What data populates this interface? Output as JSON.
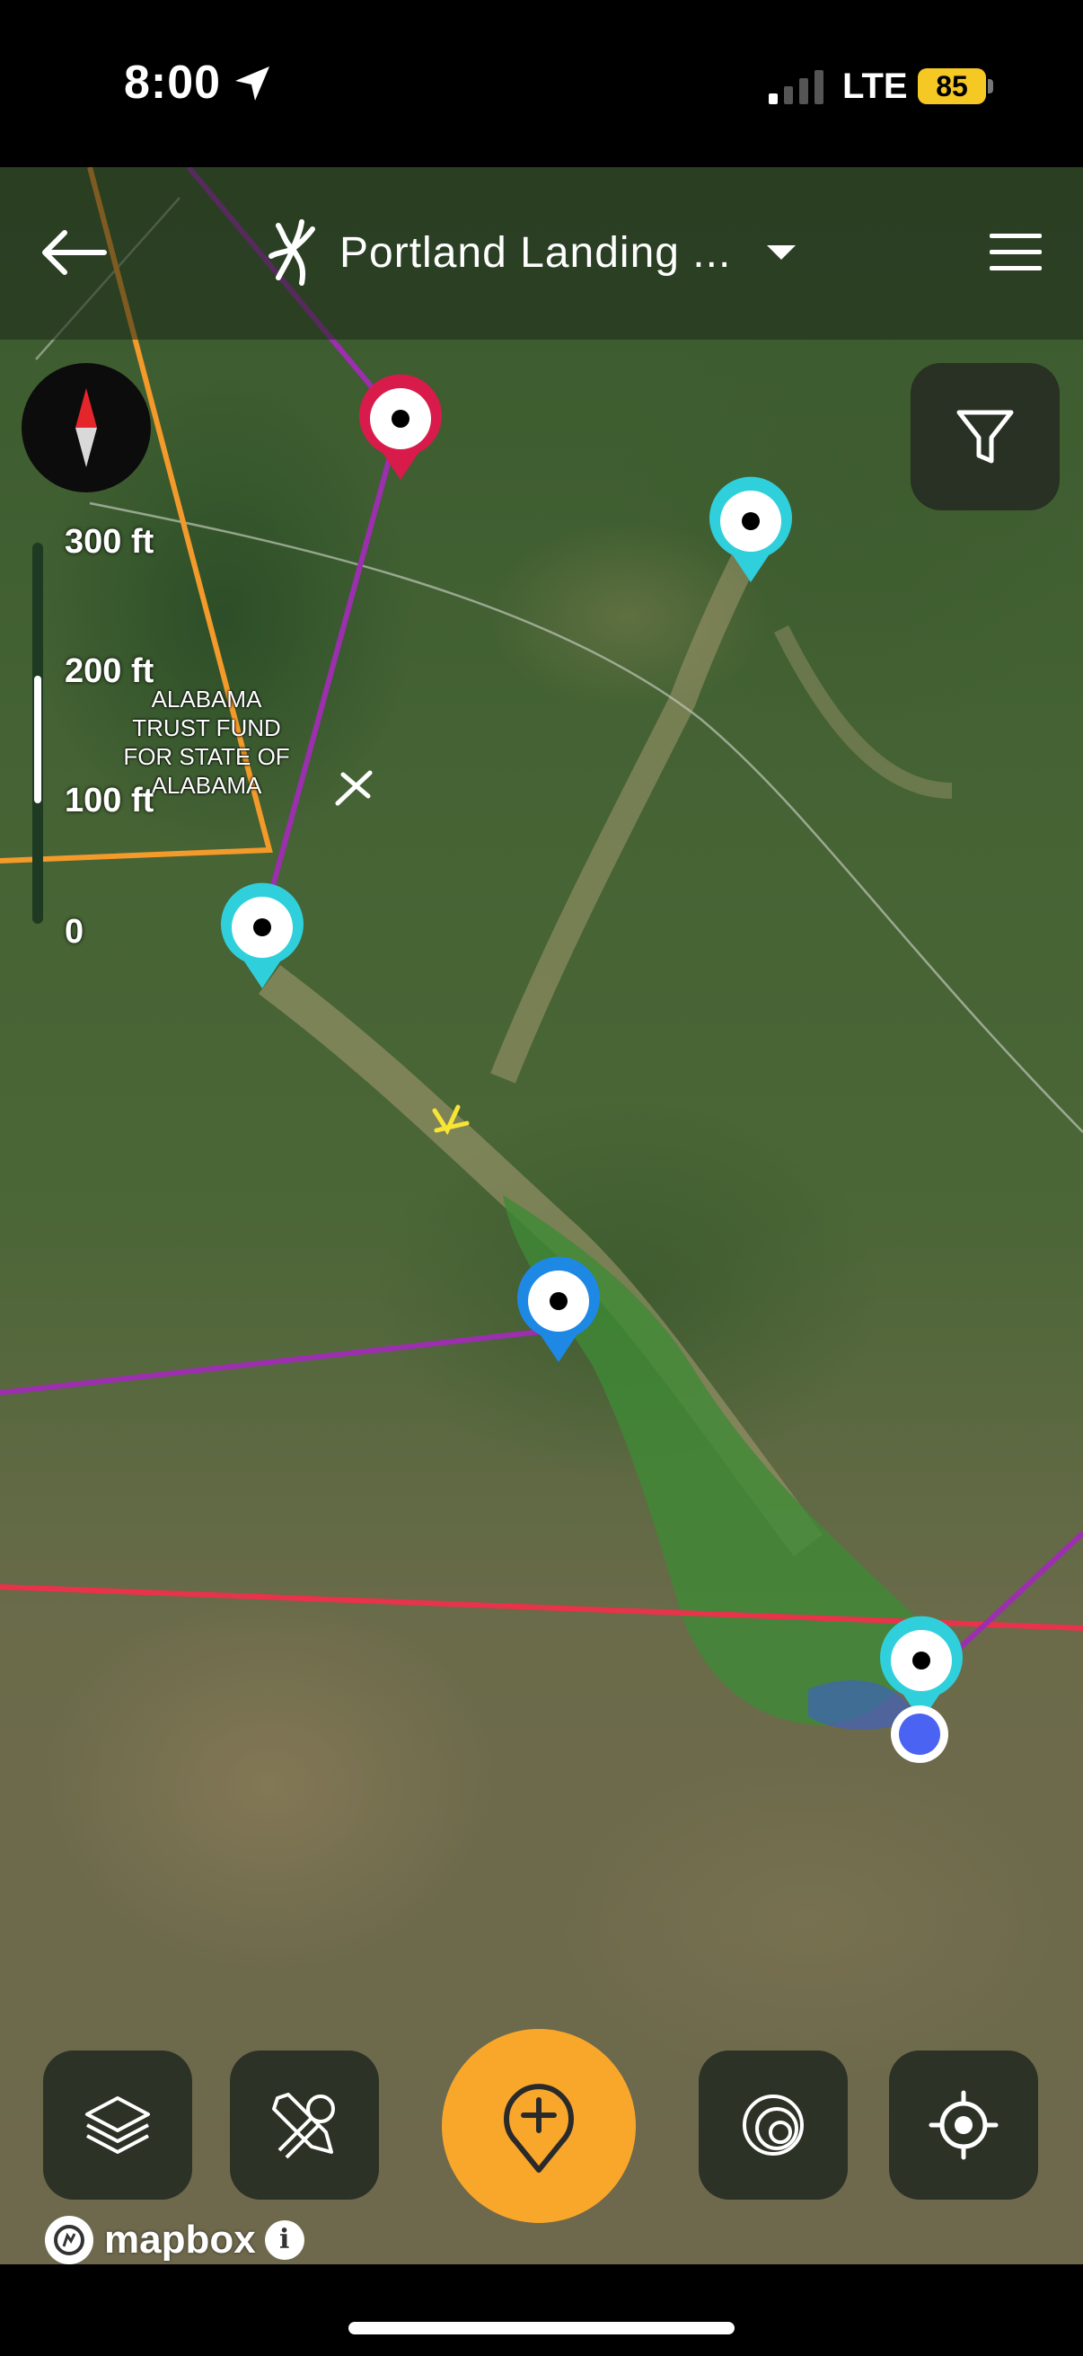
{
  "status_bar": {
    "time": "8:00",
    "network": "LTE",
    "battery": "85",
    "icons": [
      "location-arrow-icon",
      "signal-bars-icon",
      "battery-icon"
    ]
  },
  "header": {
    "title": "Portland Landing ...",
    "icons": [
      "back-arrow-icon",
      "buck-logo-icon",
      "dropdown-caret-icon",
      "hamburger-menu-icon"
    ]
  },
  "map": {
    "scale_labels": [
      "300 ft",
      "200 ft",
      "100 ft",
      "0"
    ],
    "property_label": [
      "ALABAMA",
      "TRUST FUND",
      "FOR STATE OF",
      "ALABAMA"
    ],
    "colors": {
      "boundary_orange": "#f39a2a",
      "route_purple": "#9b2fae",
      "line_red": "#e8334a",
      "pin_cyan": "#2fd0dc",
      "pin_blue": "#1e88e5",
      "pin_crimson": "#d81b4a",
      "user_location": "#4a63f2"
    },
    "attribution": "mapbox"
  },
  "controls": {
    "icons": [
      "compass-icon",
      "filter-icon",
      "layers-icon",
      "tools-icon",
      "add-pin-icon",
      "rings-icon",
      "locate-me-icon",
      "info-icon"
    ]
  }
}
